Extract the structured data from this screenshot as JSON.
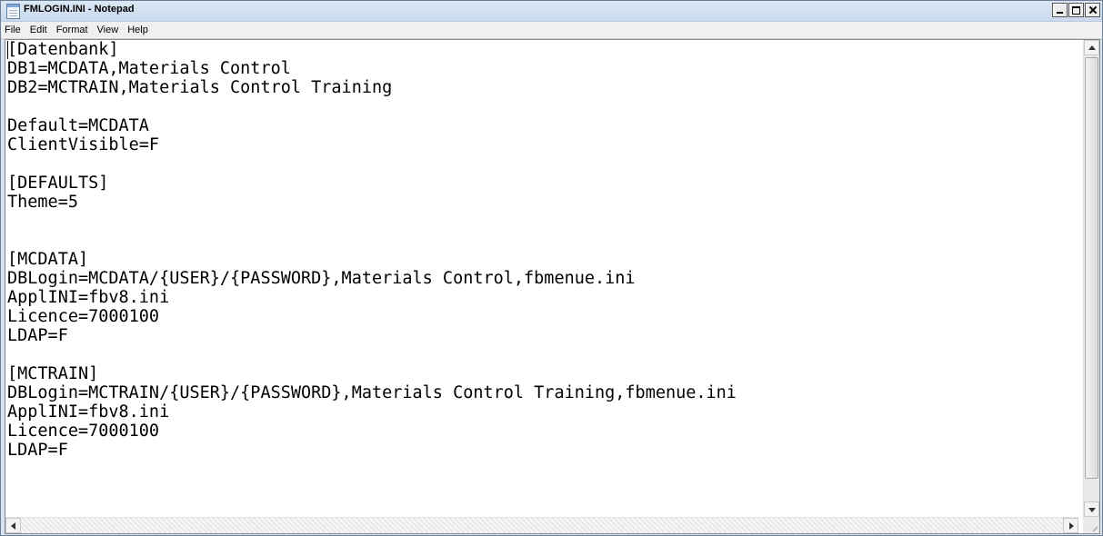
{
  "window": {
    "title": "FMLOGIN.INI - Notepad"
  },
  "menu": [
    {
      "label": "File"
    },
    {
      "label": "Edit"
    },
    {
      "label": "Format"
    },
    {
      "label": "View"
    },
    {
      "label": "Help"
    }
  ],
  "editor": {
    "lines": [
      "[Datenbank]",
      "DB1=MCDATA,Materials Control",
      "DB2=MCTRAIN,Materials Control Training",
      "",
      "Default=MCDATA",
      "ClientVisible=F",
      "",
      "[DEFAULTS]",
      "Theme=5",
      "",
      "",
      "[MCDATA]",
      "DBLogin=MCDATA/{USER}/{PASSWORD},Materials Control,fbmenue.ini",
      "ApplINI=fbv8.ini",
      "Licence=7000100",
      "LDAP=F",
      "",
      "[MCTRAIN]",
      "DBLogin=MCTRAIN/{USER}/{PASSWORD},Materials Control Training,fbmenue.ini",
      "ApplINI=fbv8.ini",
      "Licence=7000100",
      "LDAP=F"
    ]
  },
  "icons": {
    "app": "notepad-icon",
    "minimize": "minimize-icon",
    "maximize": "maximize-icon",
    "close": "close-icon"
  }
}
